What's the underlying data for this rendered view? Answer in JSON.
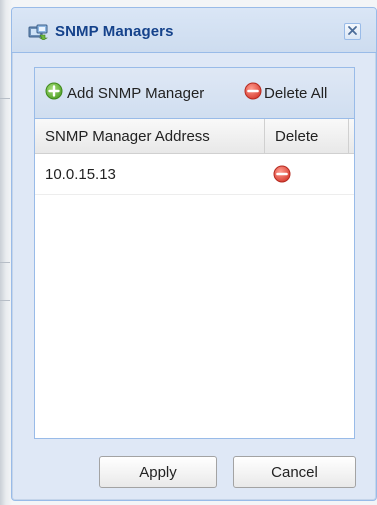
{
  "dialog": {
    "title": "SNMP Managers",
    "title_icon": "network-server-icon",
    "close_icon": "close-icon"
  },
  "toolbar": {
    "add_label": "Add SNMP Manager",
    "add_icon": "add-circle-icon",
    "delete_all_label": "Delete All",
    "delete_all_icon": "remove-circle-icon"
  },
  "grid": {
    "columns": [
      "SNMP Manager Address",
      "Delete"
    ],
    "rows": [
      {
        "address": "10.0.15.13",
        "delete_icon": "remove-circle-icon"
      }
    ]
  },
  "footer": {
    "apply_label": "Apply",
    "cancel_label": "Cancel"
  },
  "colors": {
    "title_text": "#15428b",
    "border": "#99bbe8",
    "dialog_bg": "#dfe8f6",
    "add_green": "#5fb336",
    "remove_red": "#e05a4f"
  }
}
